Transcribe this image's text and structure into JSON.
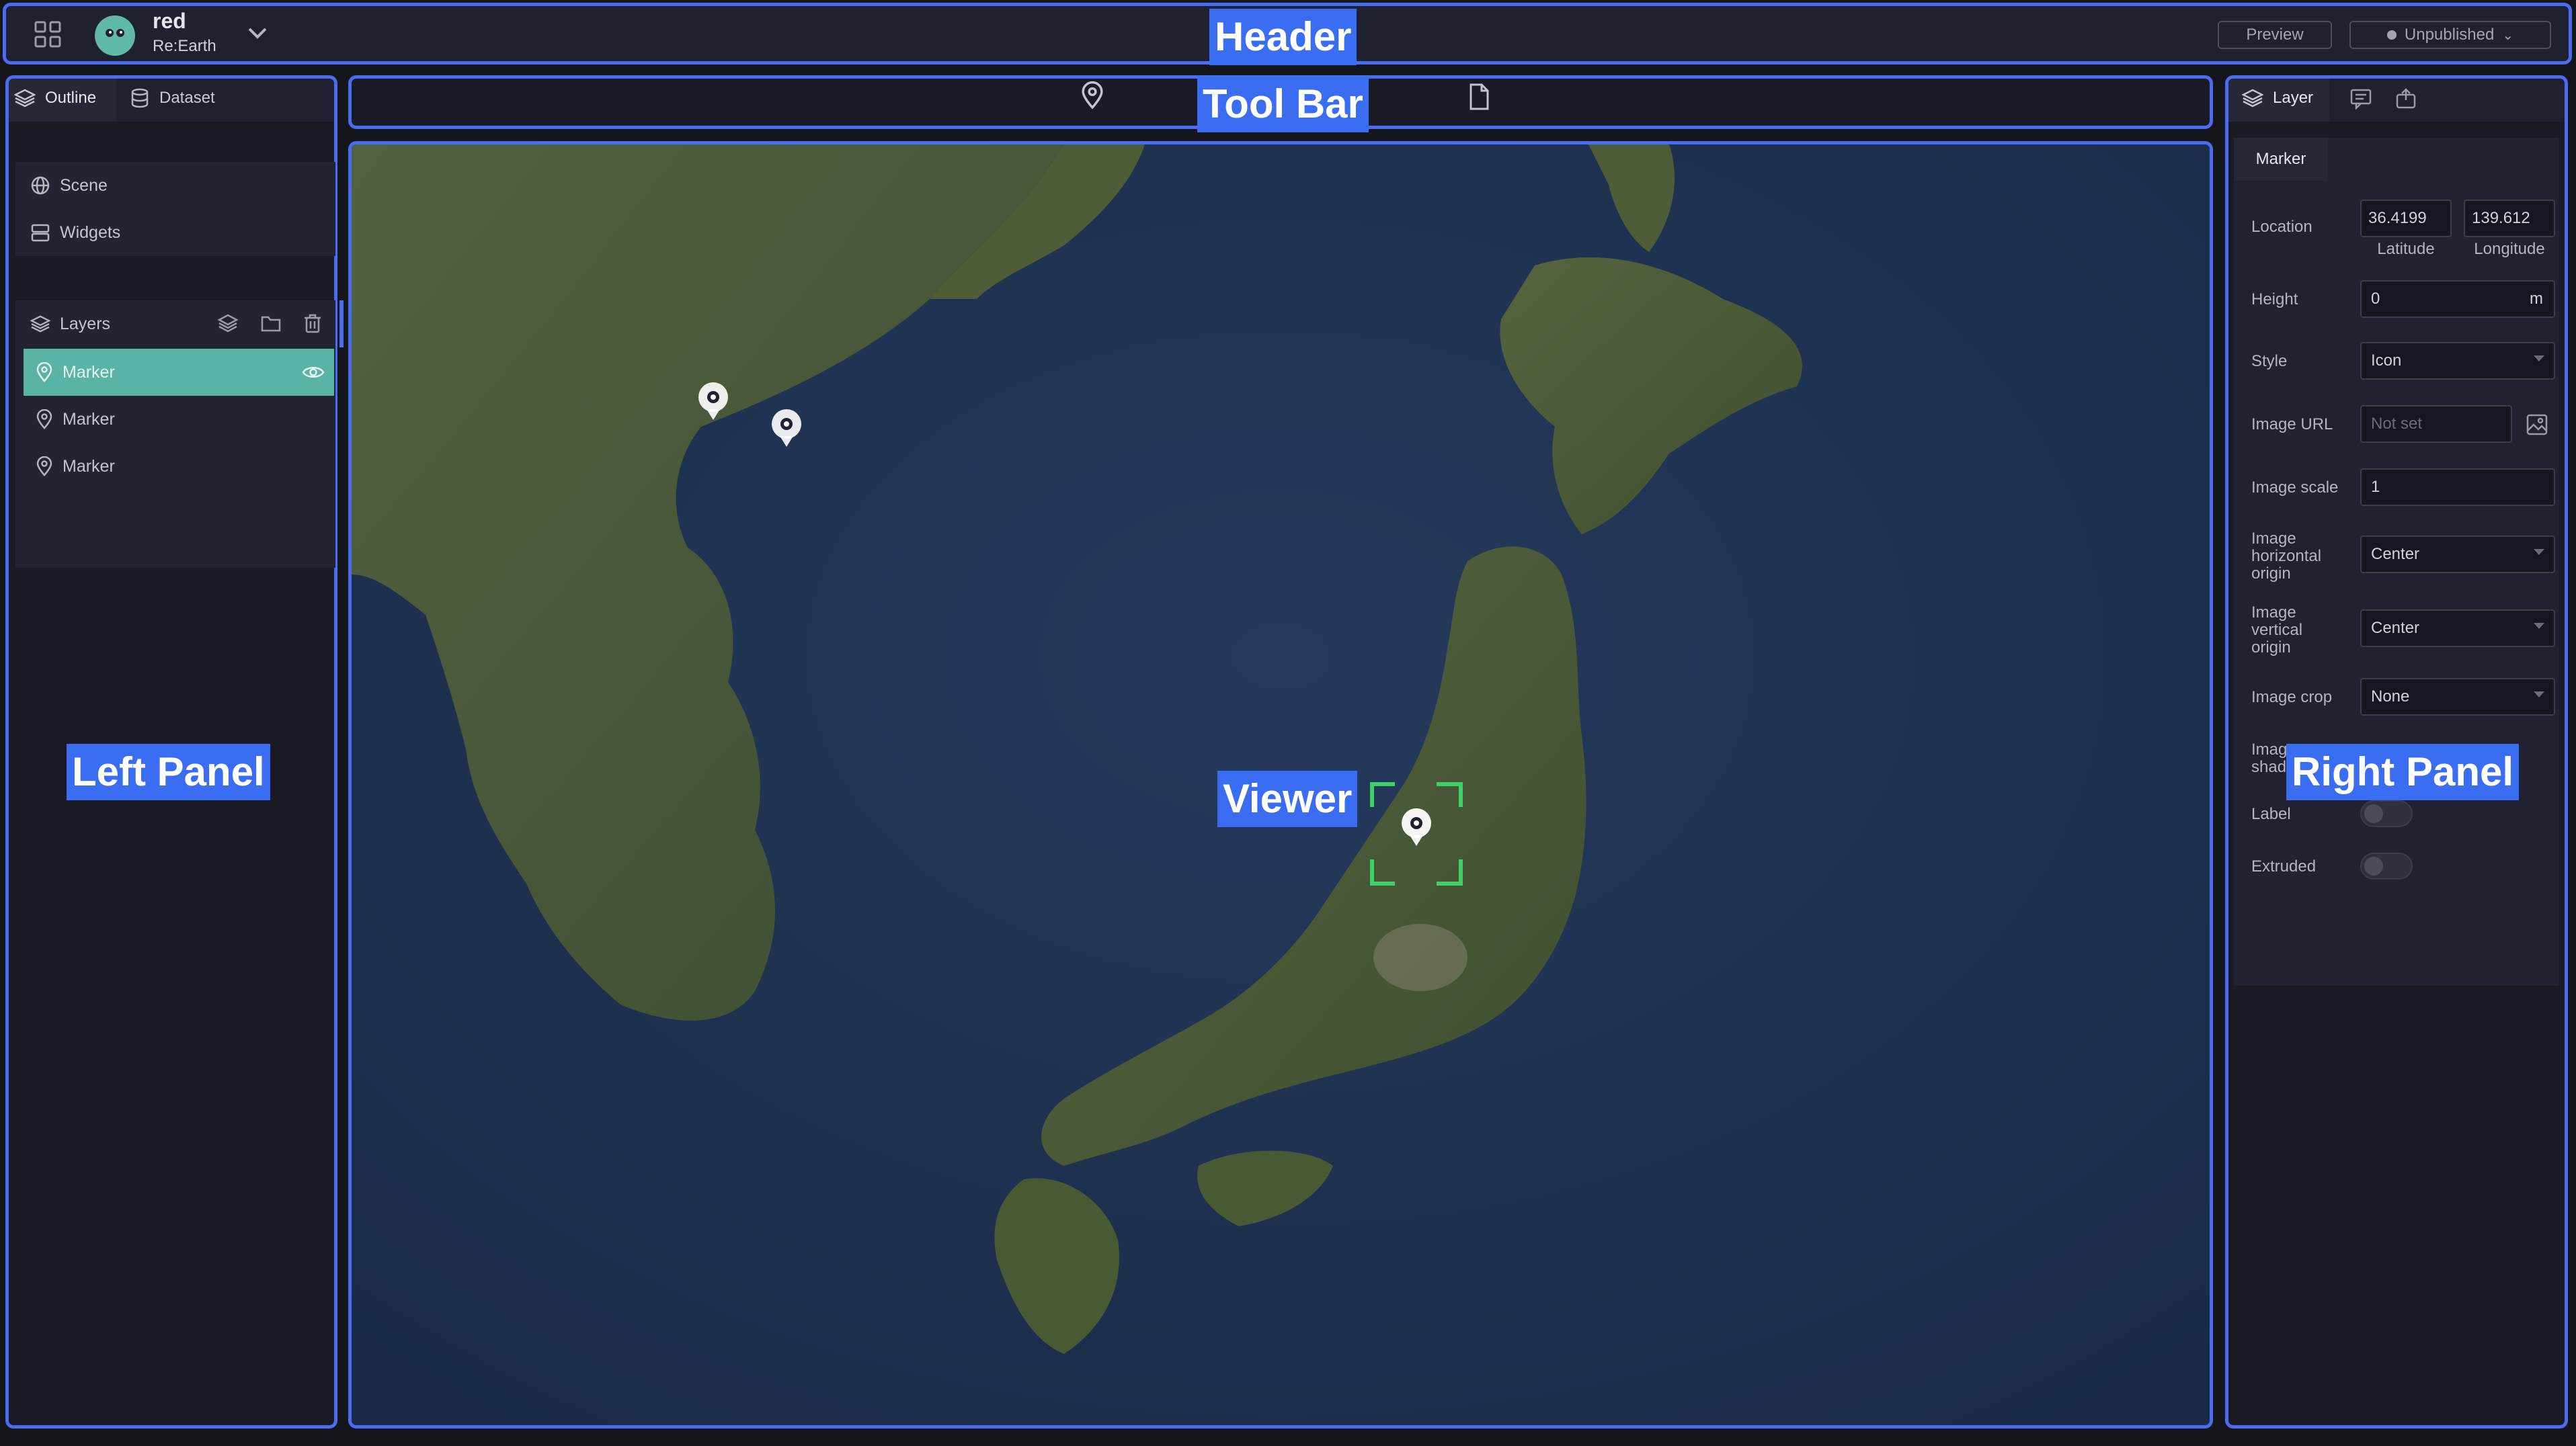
{
  "header": {
    "project_name": "red",
    "workspace_name": "Re:Earth",
    "preview_label": "Preview",
    "publish_status": "Unpublished",
    "annotation": "Header"
  },
  "left_panel": {
    "annotation": "Left Panel",
    "tabs": [
      {
        "label": "Outline",
        "icon": "layers-icon"
      },
      {
        "label": "Dataset",
        "icon": "database-icon"
      }
    ],
    "outline_items": [
      {
        "label": "Scene",
        "icon": "globe-icon"
      },
      {
        "label": "Widgets",
        "icon": "widgets-icon"
      }
    ],
    "layers_title": "Layers",
    "layers": [
      {
        "label": "Marker",
        "selected": true
      },
      {
        "label": "Marker",
        "selected": false
      },
      {
        "label": "Marker",
        "selected": false
      }
    ]
  },
  "toolbar": {
    "annotation": "Tool Bar"
  },
  "viewer": {
    "annotation": "Viewer"
  },
  "right_panel": {
    "annotation": "Right Panel",
    "tabs": [
      {
        "label": "Layer",
        "icon": "layers-icon"
      },
      {
        "label": "",
        "icon": "infobox-icon"
      },
      {
        "label": "",
        "icon": "export-icon"
      }
    ],
    "section_tab": "Marker",
    "location": {
      "label": "Location",
      "latitude": "36.4199",
      "longitude": "139.612",
      "latitude_label": "Latitude",
      "longitude_label": "Longitude"
    },
    "height": {
      "label": "Height",
      "value": "0",
      "unit": "m"
    },
    "style": {
      "label": "Style",
      "value": "Icon"
    },
    "image_url": {
      "label": "Image URL",
      "placeholder": "Not set"
    },
    "image_scale": {
      "label": "Image scale",
      "value": "1"
    },
    "image_horizontal_origin": {
      "label_lines": [
        "Image",
        "horizontal",
        "origin"
      ],
      "value": "Center"
    },
    "image_vertical_origin": {
      "label_lines": [
        "Image",
        "vertical",
        "origin"
      ],
      "value": "Center"
    },
    "image_crop": {
      "label": "Image crop",
      "value": "None"
    },
    "image_shadow": {
      "label_lines": [
        "Imag",
        "shad"
      ]
    },
    "label_toggle": {
      "label": "Label",
      "on": false
    },
    "extruded_toggle": {
      "label": "Extruded",
      "on": false
    }
  },
  "colors": {
    "accent": "#4a6cf0",
    "selected_layer": "#59b3a6",
    "panel_bg": "#1a1b25"
  }
}
